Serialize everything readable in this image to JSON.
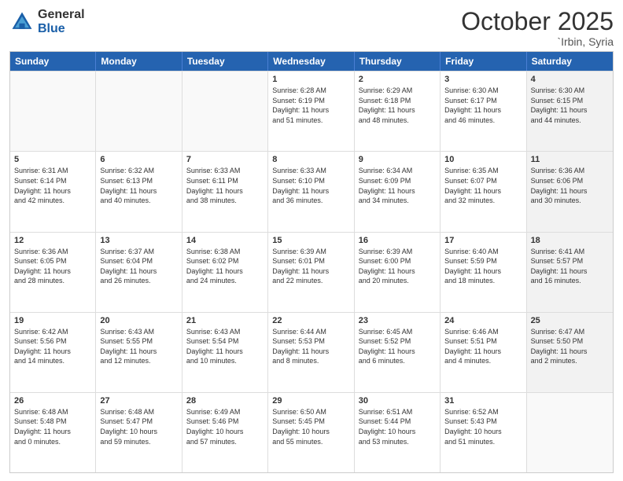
{
  "logo": {
    "general": "General",
    "blue": "Blue"
  },
  "header": {
    "month": "October 2025",
    "location": "`Irbin, Syria"
  },
  "weekdays": [
    "Sunday",
    "Monday",
    "Tuesday",
    "Wednesday",
    "Thursday",
    "Friday",
    "Saturday"
  ],
  "rows": [
    [
      {
        "day": "",
        "text": "",
        "shaded": false,
        "empty": true
      },
      {
        "day": "",
        "text": "",
        "shaded": false,
        "empty": true
      },
      {
        "day": "",
        "text": "",
        "shaded": false,
        "empty": true
      },
      {
        "day": "1",
        "text": "Sunrise: 6:28 AM\nSunset: 6:19 PM\nDaylight: 11 hours\nand 51 minutes.",
        "shaded": false,
        "empty": false
      },
      {
        "day": "2",
        "text": "Sunrise: 6:29 AM\nSunset: 6:18 PM\nDaylight: 11 hours\nand 48 minutes.",
        "shaded": false,
        "empty": false
      },
      {
        "day": "3",
        "text": "Sunrise: 6:30 AM\nSunset: 6:17 PM\nDaylight: 11 hours\nand 46 minutes.",
        "shaded": false,
        "empty": false
      },
      {
        "day": "4",
        "text": "Sunrise: 6:30 AM\nSunset: 6:15 PM\nDaylight: 11 hours\nand 44 minutes.",
        "shaded": true,
        "empty": false
      }
    ],
    [
      {
        "day": "5",
        "text": "Sunrise: 6:31 AM\nSunset: 6:14 PM\nDaylight: 11 hours\nand 42 minutes.",
        "shaded": false,
        "empty": false
      },
      {
        "day": "6",
        "text": "Sunrise: 6:32 AM\nSunset: 6:13 PM\nDaylight: 11 hours\nand 40 minutes.",
        "shaded": false,
        "empty": false
      },
      {
        "day": "7",
        "text": "Sunrise: 6:33 AM\nSunset: 6:11 PM\nDaylight: 11 hours\nand 38 minutes.",
        "shaded": false,
        "empty": false
      },
      {
        "day": "8",
        "text": "Sunrise: 6:33 AM\nSunset: 6:10 PM\nDaylight: 11 hours\nand 36 minutes.",
        "shaded": false,
        "empty": false
      },
      {
        "day": "9",
        "text": "Sunrise: 6:34 AM\nSunset: 6:09 PM\nDaylight: 11 hours\nand 34 minutes.",
        "shaded": false,
        "empty": false
      },
      {
        "day": "10",
        "text": "Sunrise: 6:35 AM\nSunset: 6:07 PM\nDaylight: 11 hours\nand 32 minutes.",
        "shaded": false,
        "empty": false
      },
      {
        "day": "11",
        "text": "Sunrise: 6:36 AM\nSunset: 6:06 PM\nDaylight: 11 hours\nand 30 minutes.",
        "shaded": true,
        "empty": false
      }
    ],
    [
      {
        "day": "12",
        "text": "Sunrise: 6:36 AM\nSunset: 6:05 PM\nDaylight: 11 hours\nand 28 minutes.",
        "shaded": false,
        "empty": false
      },
      {
        "day": "13",
        "text": "Sunrise: 6:37 AM\nSunset: 6:04 PM\nDaylight: 11 hours\nand 26 minutes.",
        "shaded": false,
        "empty": false
      },
      {
        "day": "14",
        "text": "Sunrise: 6:38 AM\nSunset: 6:02 PM\nDaylight: 11 hours\nand 24 minutes.",
        "shaded": false,
        "empty": false
      },
      {
        "day": "15",
        "text": "Sunrise: 6:39 AM\nSunset: 6:01 PM\nDaylight: 11 hours\nand 22 minutes.",
        "shaded": false,
        "empty": false
      },
      {
        "day": "16",
        "text": "Sunrise: 6:39 AM\nSunset: 6:00 PM\nDaylight: 11 hours\nand 20 minutes.",
        "shaded": false,
        "empty": false
      },
      {
        "day": "17",
        "text": "Sunrise: 6:40 AM\nSunset: 5:59 PM\nDaylight: 11 hours\nand 18 minutes.",
        "shaded": false,
        "empty": false
      },
      {
        "day": "18",
        "text": "Sunrise: 6:41 AM\nSunset: 5:57 PM\nDaylight: 11 hours\nand 16 minutes.",
        "shaded": true,
        "empty": false
      }
    ],
    [
      {
        "day": "19",
        "text": "Sunrise: 6:42 AM\nSunset: 5:56 PM\nDaylight: 11 hours\nand 14 minutes.",
        "shaded": false,
        "empty": false
      },
      {
        "day": "20",
        "text": "Sunrise: 6:43 AM\nSunset: 5:55 PM\nDaylight: 11 hours\nand 12 minutes.",
        "shaded": false,
        "empty": false
      },
      {
        "day": "21",
        "text": "Sunrise: 6:43 AM\nSunset: 5:54 PM\nDaylight: 11 hours\nand 10 minutes.",
        "shaded": false,
        "empty": false
      },
      {
        "day": "22",
        "text": "Sunrise: 6:44 AM\nSunset: 5:53 PM\nDaylight: 11 hours\nand 8 minutes.",
        "shaded": false,
        "empty": false
      },
      {
        "day": "23",
        "text": "Sunrise: 6:45 AM\nSunset: 5:52 PM\nDaylight: 11 hours\nand 6 minutes.",
        "shaded": false,
        "empty": false
      },
      {
        "day": "24",
        "text": "Sunrise: 6:46 AM\nSunset: 5:51 PM\nDaylight: 11 hours\nand 4 minutes.",
        "shaded": false,
        "empty": false
      },
      {
        "day": "25",
        "text": "Sunrise: 6:47 AM\nSunset: 5:50 PM\nDaylight: 11 hours\nand 2 minutes.",
        "shaded": true,
        "empty": false
      }
    ],
    [
      {
        "day": "26",
        "text": "Sunrise: 6:48 AM\nSunset: 5:48 PM\nDaylight: 11 hours\nand 0 minutes.",
        "shaded": false,
        "empty": false
      },
      {
        "day": "27",
        "text": "Sunrise: 6:48 AM\nSunset: 5:47 PM\nDaylight: 10 hours\nand 59 minutes.",
        "shaded": false,
        "empty": false
      },
      {
        "day": "28",
        "text": "Sunrise: 6:49 AM\nSunset: 5:46 PM\nDaylight: 10 hours\nand 57 minutes.",
        "shaded": false,
        "empty": false
      },
      {
        "day": "29",
        "text": "Sunrise: 6:50 AM\nSunset: 5:45 PM\nDaylight: 10 hours\nand 55 minutes.",
        "shaded": false,
        "empty": false
      },
      {
        "day": "30",
        "text": "Sunrise: 6:51 AM\nSunset: 5:44 PM\nDaylight: 10 hours\nand 53 minutes.",
        "shaded": false,
        "empty": false
      },
      {
        "day": "31",
        "text": "Sunrise: 6:52 AM\nSunset: 5:43 PM\nDaylight: 10 hours\nand 51 minutes.",
        "shaded": false,
        "empty": false
      },
      {
        "day": "",
        "text": "",
        "shaded": true,
        "empty": true
      }
    ]
  ]
}
